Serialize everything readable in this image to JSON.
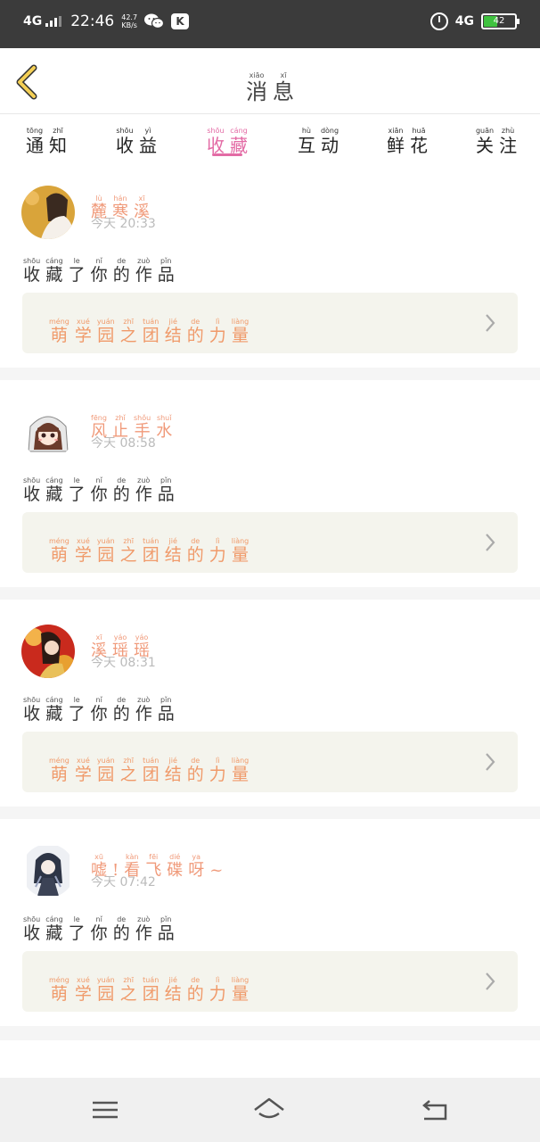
{
  "status_bar": {
    "network": "4G",
    "time": "22:46",
    "speed_value": "42.7",
    "speed_unit": "KB/s",
    "app_badge": "K",
    "network_right": "4G",
    "battery": "42",
    "battery_level": 0.42
  },
  "header": {
    "title": [
      {
        "ch": "消",
        "py": "xiāo"
      },
      {
        "ch": "息",
        "py": "xī"
      }
    ]
  },
  "tabs": [
    {
      "label": [
        {
          "ch": "通",
          "py": "tōng"
        },
        {
          "ch": "知",
          "py": "zhī"
        }
      ],
      "active": false
    },
    {
      "label": [
        {
          "ch": "收",
          "py": "shōu"
        },
        {
          "ch": "益",
          "py": "yì"
        }
      ],
      "active": false
    },
    {
      "label": [
        {
          "ch": "收",
          "py": "shōu"
        },
        {
          "ch": "藏",
          "py": "cáng"
        }
      ],
      "active": true
    },
    {
      "label": [
        {
          "ch": "互",
          "py": "hù"
        },
        {
          "ch": "动",
          "py": "dòng"
        }
      ],
      "active": false
    },
    {
      "label": [
        {
          "ch": "鲜",
          "py": "xiān"
        },
        {
          "ch": "花",
          "py": "huā"
        }
      ],
      "active": false
    },
    {
      "label": [
        {
          "ch": "关",
          "py": "guān"
        },
        {
          "ch": "注",
          "py": "zhù"
        }
      ],
      "active": false
    }
  ],
  "colors": {
    "accent": "#e36ba5",
    "name": "#f09a7a",
    "work_bg": "#f4f4ed"
  },
  "items": [
    {
      "user": [
        {
          "ch": "麓",
          "py": "lù"
        },
        {
          "ch": "寒",
          "py": "hán"
        },
        {
          "ch": "溪",
          "py": "xī"
        }
      ],
      "day": "今天",
      "time": "20:33",
      "action": [
        {
          "ch": "收",
          "py": "shōu"
        },
        {
          "ch": "藏",
          "py": "cáng"
        },
        {
          "ch": "了",
          "py": "le"
        },
        {
          "ch": "你",
          "py": "nǐ"
        },
        {
          "ch": "的",
          "py": "de"
        },
        {
          "ch": "作",
          "py": "zuò"
        },
        {
          "ch": "品",
          "py": "pǐn"
        }
      ],
      "work": [
        {
          "ch": "萌",
          "py": "méng"
        },
        {
          "ch": "学",
          "py": "xué"
        },
        {
          "ch": "园",
          "py": "yuán"
        },
        {
          "ch": "之",
          "py": "zhī"
        },
        {
          "ch": "团",
          "py": "tuán"
        },
        {
          "ch": "结",
          "py": "jié"
        },
        {
          "ch": "的",
          "py": "de"
        },
        {
          "ch": "力",
          "py": "lì"
        },
        {
          "ch": "量",
          "py": "liàng"
        }
      ]
    },
    {
      "user": [
        {
          "ch": "风",
          "py": "fēng"
        },
        {
          "ch": "止",
          "py": "zhǐ"
        },
        {
          "ch": "手",
          "py": "shǒu"
        },
        {
          "ch": "水",
          "py": "shuǐ"
        }
      ],
      "day": "今天",
      "time": "08:58",
      "action": [
        {
          "ch": "收",
          "py": "shōu"
        },
        {
          "ch": "藏",
          "py": "cáng"
        },
        {
          "ch": "了",
          "py": "le"
        },
        {
          "ch": "你",
          "py": "nǐ"
        },
        {
          "ch": "的",
          "py": "de"
        },
        {
          "ch": "作",
          "py": "zuò"
        },
        {
          "ch": "品",
          "py": "pǐn"
        }
      ],
      "work": [
        {
          "ch": "萌",
          "py": "méng"
        },
        {
          "ch": "学",
          "py": "xué"
        },
        {
          "ch": "园",
          "py": "yuán"
        },
        {
          "ch": "之",
          "py": "zhī"
        },
        {
          "ch": "团",
          "py": "tuán"
        },
        {
          "ch": "结",
          "py": "jié"
        },
        {
          "ch": "的",
          "py": "de"
        },
        {
          "ch": "力",
          "py": "lì"
        },
        {
          "ch": "量",
          "py": "liàng"
        }
      ]
    },
    {
      "user": [
        {
          "ch": "溪",
          "py": "xī"
        },
        {
          "ch": "瑶",
          "py": "yáo"
        },
        {
          "ch": "瑶",
          "py": "yáo"
        }
      ],
      "day": "今天",
      "time": "08:31",
      "action": [
        {
          "ch": "收",
          "py": "shōu"
        },
        {
          "ch": "藏",
          "py": "cáng"
        },
        {
          "ch": "了",
          "py": "le"
        },
        {
          "ch": "你",
          "py": "nǐ"
        },
        {
          "ch": "的",
          "py": "de"
        },
        {
          "ch": "作",
          "py": "zuò"
        },
        {
          "ch": "品",
          "py": "pǐn"
        }
      ],
      "work": [
        {
          "ch": "萌",
          "py": "méng"
        },
        {
          "ch": "学",
          "py": "xué"
        },
        {
          "ch": "园",
          "py": "yuán"
        },
        {
          "ch": "之",
          "py": "zhī"
        },
        {
          "ch": "团",
          "py": "tuán"
        },
        {
          "ch": "结",
          "py": "jié"
        },
        {
          "ch": "的",
          "py": "de"
        },
        {
          "ch": "力",
          "py": "lì"
        },
        {
          "ch": "量",
          "py": "liàng"
        }
      ]
    },
    {
      "user": [
        {
          "ch": "嘘",
          "py": "xū"
        },
        {
          "ch": "!",
          "py": ""
        },
        {
          "ch": "看",
          "py": "kàn"
        },
        {
          "ch": "飞",
          "py": "fēi"
        },
        {
          "ch": "碟",
          "py": "dié"
        },
        {
          "ch": "呀",
          "py": "ya"
        },
        {
          "ch": "~",
          "py": ""
        }
      ],
      "day": "今天",
      "time": "07:42",
      "action": [
        {
          "ch": "收",
          "py": "shōu"
        },
        {
          "ch": "藏",
          "py": "cáng"
        },
        {
          "ch": "了",
          "py": "le"
        },
        {
          "ch": "你",
          "py": "nǐ"
        },
        {
          "ch": "的",
          "py": "de"
        },
        {
          "ch": "作",
          "py": "zuò"
        },
        {
          "ch": "品",
          "py": "pǐn"
        }
      ],
      "work": [
        {
          "ch": "萌",
          "py": "méng"
        },
        {
          "ch": "学",
          "py": "xué"
        },
        {
          "ch": "园",
          "py": "yuán"
        },
        {
          "ch": "之",
          "py": "zhī"
        },
        {
          "ch": "团",
          "py": "tuán"
        },
        {
          "ch": "结",
          "py": "jié"
        },
        {
          "ch": "的",
          "py": "de"
        },
        {
          "ch": "力",
          "py": "lì"
        },
        {
          "ch": "量",
          "py": "liàng"
        }
      ]
    }
  ],
  "nav": {
    "menu_icon": "menu-icon",
    "home_icon": "home-icon",
    "back_icon": "back-icon"
  }
}
